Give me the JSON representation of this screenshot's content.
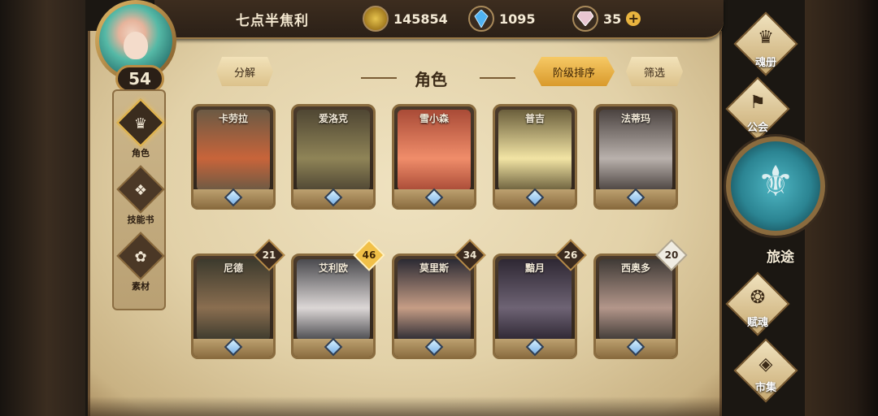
{
  "player": {
    "name": "七点半焦利",
    "level": "54"
  },
  "resources": [
    {
      "icon": "gold-coin-icon",
      "value": "145854"
    },
    {
      "icon": "blue-crystal-icon",
      "value": "1095"
    },
    {
      "icon": "pink-gem-icon",
      "value": "35"
    }
  ],
  "sidebar": {
    "items": [
      {
        "label": "角色",
        "icon": "character-icon",
        "active": true
      },
      {
        "label": "技能书",
        "icon": "skill-book-icon",
        "active": false
      },
      {
        "label": "素材",
        "icon": "material-icon",
        "active": false
      }
    ]
  },
  "toolbar": {
    "decompose": "分解",
    "title": "角色",
    "sort": "阶级排序",
    "filter": "筛选"
  },
  "cards_row1": [
    {
      "name": "卡劳拉",
      "colors": [
        "#6b5a44",
        "#c8643a"
      ]
    },
    {
      "name": "爱洛克",
      "colors": [
        "#4f4633",
        "#8f8457"
      ]
    },
    {
      "name": "雪小森",
      "colors": [
        "#a94b37",
        "#f08d6a"
      ]
    },
    {
      "name": "普吉",
      "colors": [
        "#6b5f3c",
        "#f2e4a4"
      ]
    },
    {
      "name": "法蒂玛",
      "colors": [
        "#4b4340",
        "#b9b1ac"
      ]
    }
  ],
  "cards_row2": [
    {
      "name": "尼德",
      "level": "21",
      "badge": "dark",
      "colors": [
        "#3c3a2d",
        "#8a6e50"
      ]
    },
    {
      "name": "艾利欧",
      "level": "46",
      "badge": "gold",
      "colors": [
        "#4a4a4e",
        "#dcd7d6"
      ]
    },
    {
      "name": "莫里斯",
      "level": "34",
      "badge": "dark",
      "colors": [
        "#2b2a33",
        "#c69d85"
      ]
    },
    {
      "name": "黯月",
      "level": "26",
      "badge": "dark",
      "colors": [
        "#2e2733",
        "#6e6374"
      ]
    },
    {
      "name": "西奥多",
      "level": "20",
      "badge": "white",
      "colors": [
        "#3f3a36",
        "#b3968a"
      ]
    }
  ],
  "right_menu": {
    "soul_book": "魂册",
    "guild": "公会",
    "journey": "旅途",
    "endow": "赋魂",
    "market": "市集"
  }
}
